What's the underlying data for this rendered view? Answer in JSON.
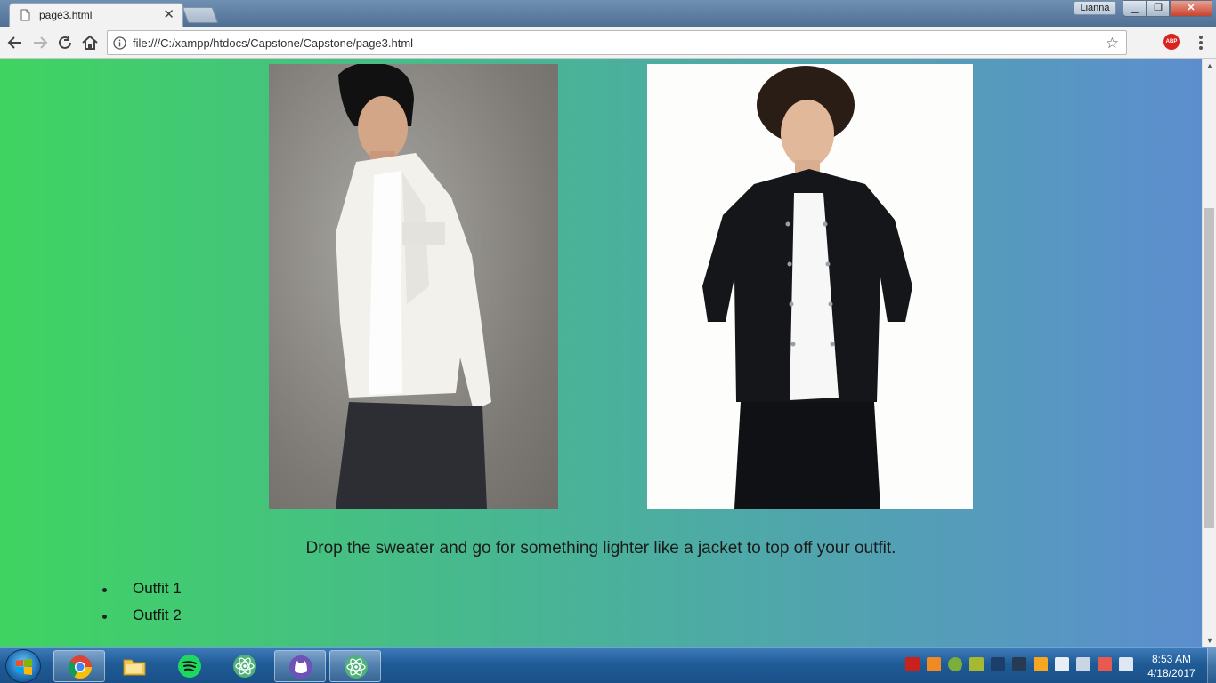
{
  "browser": {
    "tab": {
      "title": "page3.html",
      "close_glyph": "✕"
    },
    "user_badge": "Lianna",
    "window_controls": {
      "minimize": "▁",
      "maximize": "❐",
      "close": "✕"
    },
    "address_bar": {
      "url": "file:///C:/xampp/htdocs/Capstone/Capstone/page3.html",
      "star_glyph": "☆"
    },
    "extensions": {
      "adblock_label": "ABP"
    }
  },
  "page": {
    "images": [
      {
        "name": "outfit-1-photo",
        "description": "white denim jacket"
      },
      {
        "name": "outfit-2-photo",
        "description": "black bomber jacket"
      }
    ],
    "caption": "Drop the sweater and go for something lighter like a jacket to top off your outfit.",
    "outfit_links": [
      "Outfit 1",
      "Outfit 2"
    ],
    "colors": {
      "gradient_left": "#3fd461",
      "gradient_mid": "#4ab19b",
      "gradient_right": "#5c8ecf"
    }
  },
  "scrollbar": {
    "up": "▲",
    "down": "▼"
  },
  "taskbar": {
    "apps": [
      "chrome-icon",
      "file-explorer-icon",
      "spotify-icon",
      "atom-icon",
      "github-desktop-icon",
      "atom-icon"
    ],
    "clock": {
      "time": "8:53 AM",
      "date": "4/18/2017"
    }
  }
}
